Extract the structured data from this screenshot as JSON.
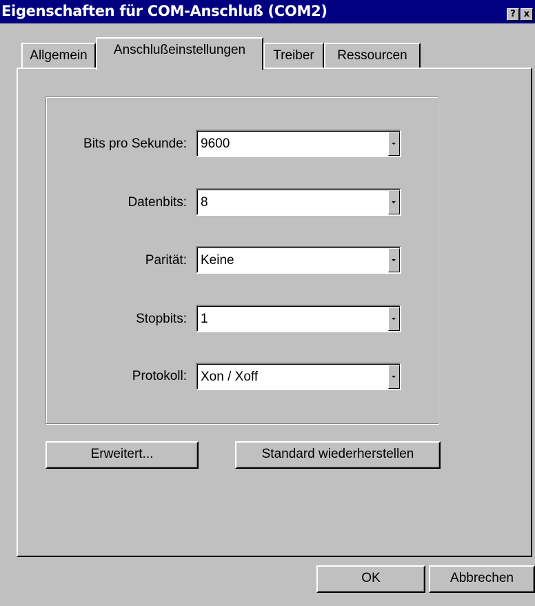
{
  "window": {
    "title": "Eigenschaften für COM-Anschluß (COM2)",
    "help_glyph": "?",
    "close_glyph": "x",
    "accent_color": "#000080",
    "face_color": "#c0c0c0"
  },
  "tabs": [
    {
      "label": "Allgemein",
      "active": false
    },
    {
      "label": "Anschlußeinstellungen",
      "active": true
    },
    {
      "label": "Treiber",
      "active": false
    },
    {
      "label": "Ressourcen",
      "active": false
    }
  ],
  "settings": {
    "bits_per_second": {
      "label": "Bits pro Sekunde:",
      "value": "9600"
    },
    "data_bits": {
      "label": "Datenbits:",
      "value": "8"
    },
    "parity": {
      "label": "Parität:",
      "value": "Keine"
    },
    "stop_bits": {
      "label": "Stopbits:",
      "value": "1"
    },
    "protocol": {
      "label": "Protokoll:",
      "value": "Xon / Xoff"
    }
  },
  "panel_buttons": {
    "advanced": "Erweitert...",
    "restore_defaults": "Standard wiederherstellen"
  },
  "dialog_buttons": {
    "ok": "OK",
    "cancel": "Abbrechen"
  }
}
